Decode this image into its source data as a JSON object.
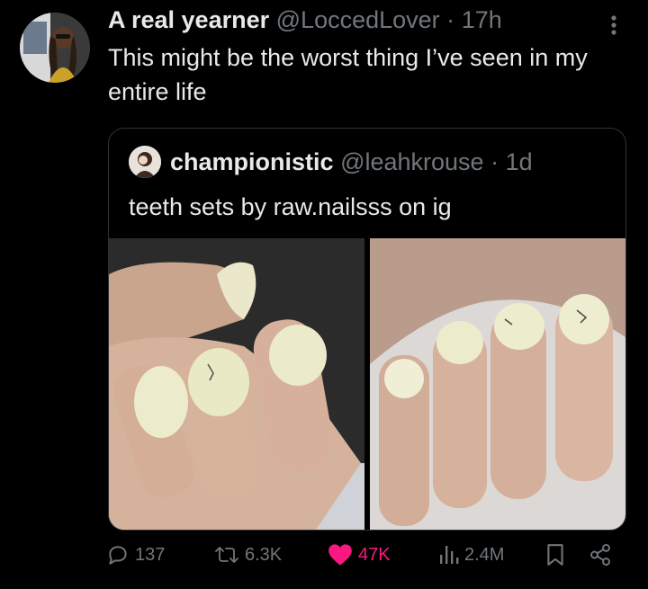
{
  "post": {
    "author_name": "A real yearner",
    "author_handle": "@LoccedLover",
    "separator": "·",
    "time": "17h",
    "text": "This might be the worst thing I’ve seen in my entire life"
  },
  "quote": {
    "author_name": "championistic",
    "author_handle": "@leahkrouse",
    "separator": "·",
    "time": "1d",
    "text": "teeth sets by raw.nailsss on ig",
    "media_count": 2
  },
  "actions": {
    "replies": "137",
    "reposts": "6.3K",
    "likes": "47K",
    "views": "2.4M"
  },
  "colors": {
    "background": "#000000",
    "text_primary": "#e7e9ea",
    "text_secondary": "#71767b",
    "like_pink": "#f91880",
    "border": "#2f3336"
  },
  "icons": [
    "more-icon",
    "reply-icon",
    "repost-icon",
    "like-icon",
    "views-icon",
    "bookmark-icon",
    "share-icon"
  ]
}
